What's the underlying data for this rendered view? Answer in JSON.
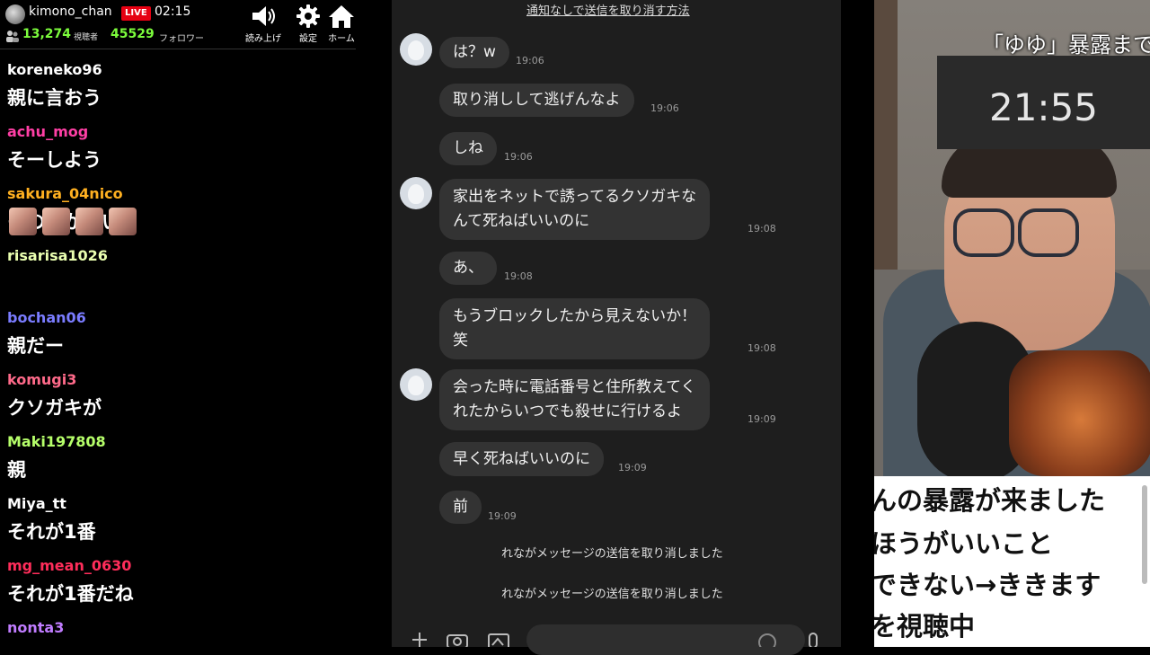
{
  "header": {
    "streamer": "kimono_chan",
    "live_badge": "LIVE",
    "time": "02:15",
    "viewers": "13,274",
    "viewers_label": "視聴者",
    "followers": "45529",
    "followers_label": "フォロワー",
    "buttons": {
      "readout": "読み上げ",
      "settings": "設定",
      "home": "ホーム"
    }
  },
  "comments": [
    {
      "user": "koreneko96",
      "color": "#ffffff",
      "text": "親に言おう"
    },
    {
      "user": "achu_mog",
      "color": "#ff3fa5",
      "text": "そーしよう"
    },
    {
      "user": "sakura_04nico",
      "color": "#ffb020",
      "text": "その方がいい"
    },
    {
      "user": "risarisa1026",
      "color": "#eaffb0",
      "text": ""
    },
    {
      "user": "bochan06",
      "color": "#7a7cff",
      "text": "親だー"
    },
    {
      "user": "komugi3",
      "color": "#ff6a8a",
      "text": "クソガキが"
    },
    {
      "user": "Maki197808",
      "color": "#b6ff6a",
      "text": "親"
    },
    {
      "user": "Miya_tt",
      "color": "#ffffff",
      "text": "それが1番"
    },
    {
      "user": "mg_mean_0630",
      "color": "#ff2d5a",
      "text": "それが1番だね"
    },
    {
      "user": "nonta3",
      "color": "#c07cff",
      "text": ""
    }
  ],
  "line": {
    "unsend_note": "通知なしで送信を取り消す方法",
    "messages": [
      {
        "text": "は？w",
        "time": "19:06"
      },
      {
        "text": "取り消しして逃げんなよ",
        "time": "19:06"
      },
      {
        "text": "しね",
        "time": "19:06"
      },
      {
        "text_line1": "家出をネットで誘ってるクソガキな",
        "text_line2": "んて死ねばいいのに",
        "time": "19:08"
      },
      {
        "text": "あ、",
        "time": "19:08"
      },
      {
        "text_line1": "もうブロックしたから見えないか！",
        "text_line2": "笑",
        "time": "19:08"
      },
      {
        "text_line1": "会った時に電話番号と住所教えてく",
        "text_line2": "れたからいつでも殺せに行けるよ",
        "time": "19:09"
      },
      {
        "text": "早く死ねばいいのに",
        "time": "19:09"
      },
      {
        "text": "前",
        "time": "19:09"
      }
    ],
    "system_messages": [
      "れながメッセージの送信を取り消しました",
      "れながメッセージの送信を取り消しました"
    ]
  },
  "webcam": {
    "title": "「ゆゆ」暴露まで",
    "timer": "21:55",
    "captions": [
      "んの暴露が来ました",
      "ほうがいいこと",
      "できない→ききます",
      "を視聴中"
    ]
  }
}
